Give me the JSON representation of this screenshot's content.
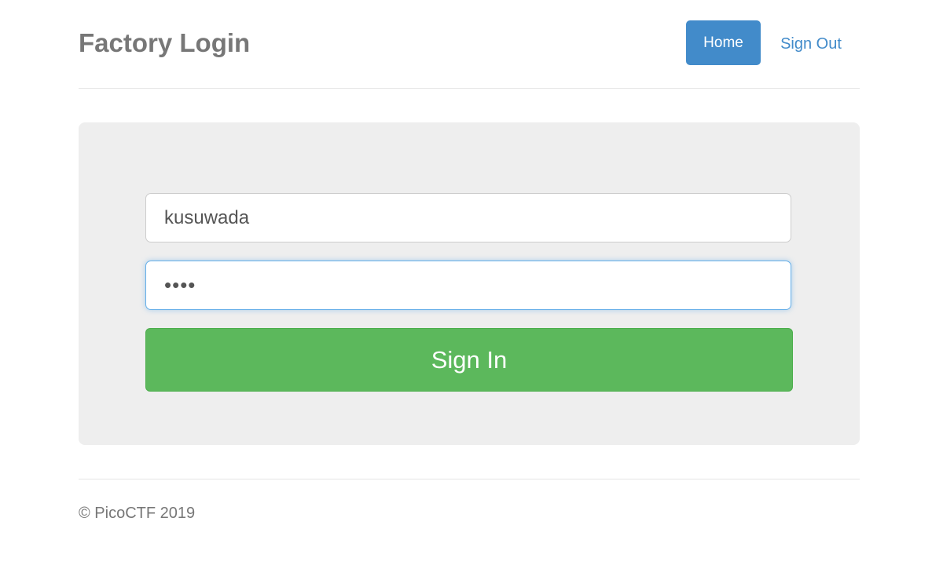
{
  "header": {
    "title": "Factory Login",
    "nav": {
      "home_label": "Home",
      "signout_label": "Sign Out"
    }
  },
  "form": {
    "username_value": "kusuwada",
    "password_value": "••••",
    "signin_label": "Sign In"
  },
  "footer": {
    "text": "© PicoCTF 2019"
  },
  "colors": {
    "primary": "#428bca",
    "success": "#5cb85c",
    "jumbotron_bg": "#eeeeee",
    "muted_text": "#777777"
  }
}
